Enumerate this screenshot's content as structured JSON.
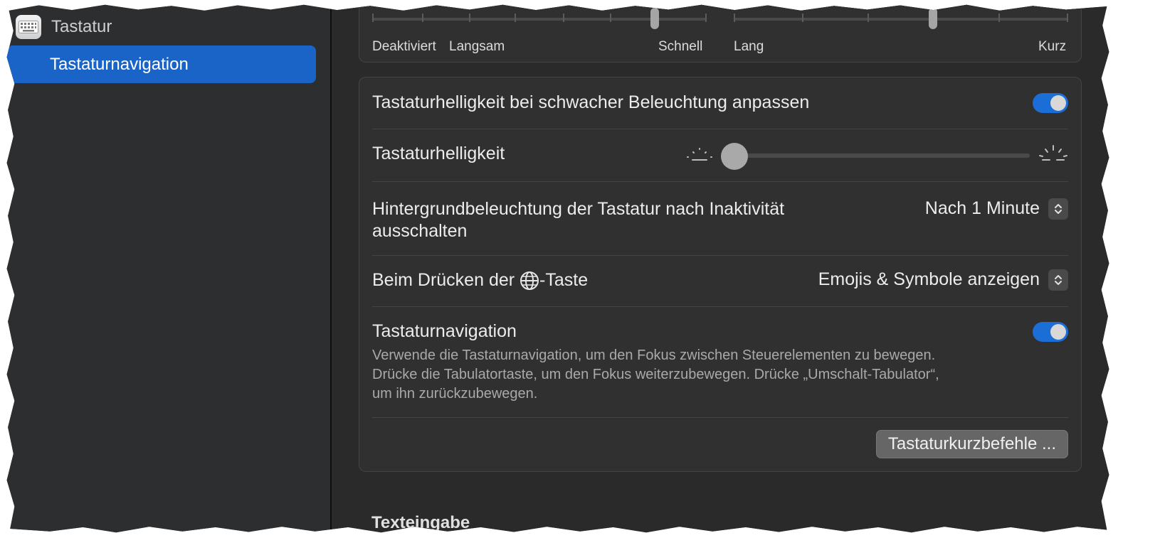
{
  "sidebar": {
    "title": "Tastatur",
    "icon": "keyboard-icon",
    "selected_item": "Tastaturnavigation",
    "accent": "#1a64c7"
  },
  "repeat": {
    "left_labels": [
      "Deaktiviert",
      "Langsam",
      "Schnell"
    ],
    "right_labels": [
      "Lang",
      "Kurz"
    ]
  },
  "settings": {
    "adjust_brightness": {
      "label": "Tastaturhelligkeit bei schwacher Beleuchtung anpassen",
      "on": true
    },
    "brightness": {
      "label": "Tastaturhelligkeit",
      "value": 0.0
    },
    "backlight_off": {
      "label_line1": "Hintergrundbeleuchtung der Tastatur nach Inaktivität",
      "label_line2": "ausschalten",
      "value": "Nach 1 Minute"
    },
    "globe_key": {
      "label_prefix": "Beim Drücken der ",
      "label_suffix": "-Taste",
      "value": "Emojis & Symbole anzeigen"
    },
    "navigation": {
      "label": "Tastaturnavigation",
      "on": true,
      "desc_line1": "Verwende die Tastaturnavigation, um den Fokus zwischen Steuerelementen zu bewegen.",
      "desc_line2": "Drücke die Tabulatortaste, um den Fokus weiterzubewegen. Drücke „Umschalt-Tabulator“,",
      "desc_line3": "um ihn zurückzubewegen."
    },
    "shortcuts_button": "Tastaturkurzbefehle ..."
  },
  "section": {
    "title": "Texteingabe"
  },
  "colors": {
    "toggle_on": "#1b6ed6"
  }
}
